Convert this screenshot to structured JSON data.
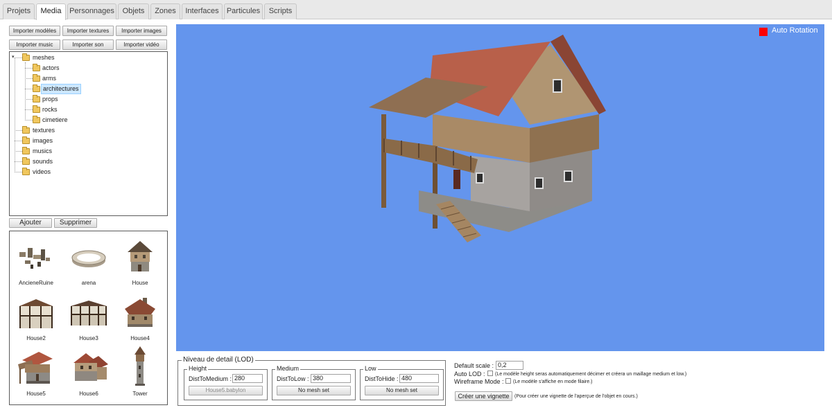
{
  "tabs": [
    "Projets",
    "Media",
    "Personnages",
    "Objets",
    "Zones",
    "Interfaces",
    "Particules",
    "Scripts"
  ],
  "import_buttons": [
    "Importer modèles",
    "Importer textures",
    "Importer images",
    "Importer music",
    "Importer son",
    "Importer vidéo"
  ],
  "tree": {
    "meshes": "meshes",
    "children": [
      "actors",
      "arms",
      "architectures",
      "props",
      "rocks",
      "cimetiere"
    ],
    "others": [
      "textures",
      "images",
      "musics",
      "sounds",
      "videos"
    ]
  },
  "actions": {
    "add": "Ajouter",
    "delete": "Supprimer"
  },
  "thumbnails": [
    "AncieneRuine",
    "arena",
    "House",
    "House2",
    "House3",
    "House4",
    "House5",
    "House6",
    "Tower"
  ],
  "viewport": {
    "auto_rotation": "Auto Rotation",
    "background": "#6495ed",
    "indicator_color": "#ff0000"
  },
  "lod": {
    "title": "Niveau de detail (LOD)",
    "height": {
      "label": "Height",
      "field": "DistToMedium :",
      "value": "280",
      "button": "House5.babylon"
    },
    "medium": {
      "label": "Medium",
      "field": "DistToLow :",
      "value": "380",
      "button": "No mesh set"
    },
    "low": {
      "label": "Low",
      "field": "DistToHide :",
      "value": "480",
      "button": "No mesh set"
    }
  },
  "settings": {
    "scale_label": "Default scale :",
    "scale_value": "0,2",
    "auto_lod_label": "Auto LOD :",
    "auto_lod_note": "(Le modèle height seras automatiquement décimer et créera un maillage medium et low.)",
    "wireframe_label": "Wireframe Mode :",
    "wireframe_note": "(Le modèle s'affiche en mode filaire.)",
    "vignette_button": "Créer une vignette",
    "vignette_note": "(Pour créer une vignette de l'aperçue de l'objet en cours.)"
  }
}
